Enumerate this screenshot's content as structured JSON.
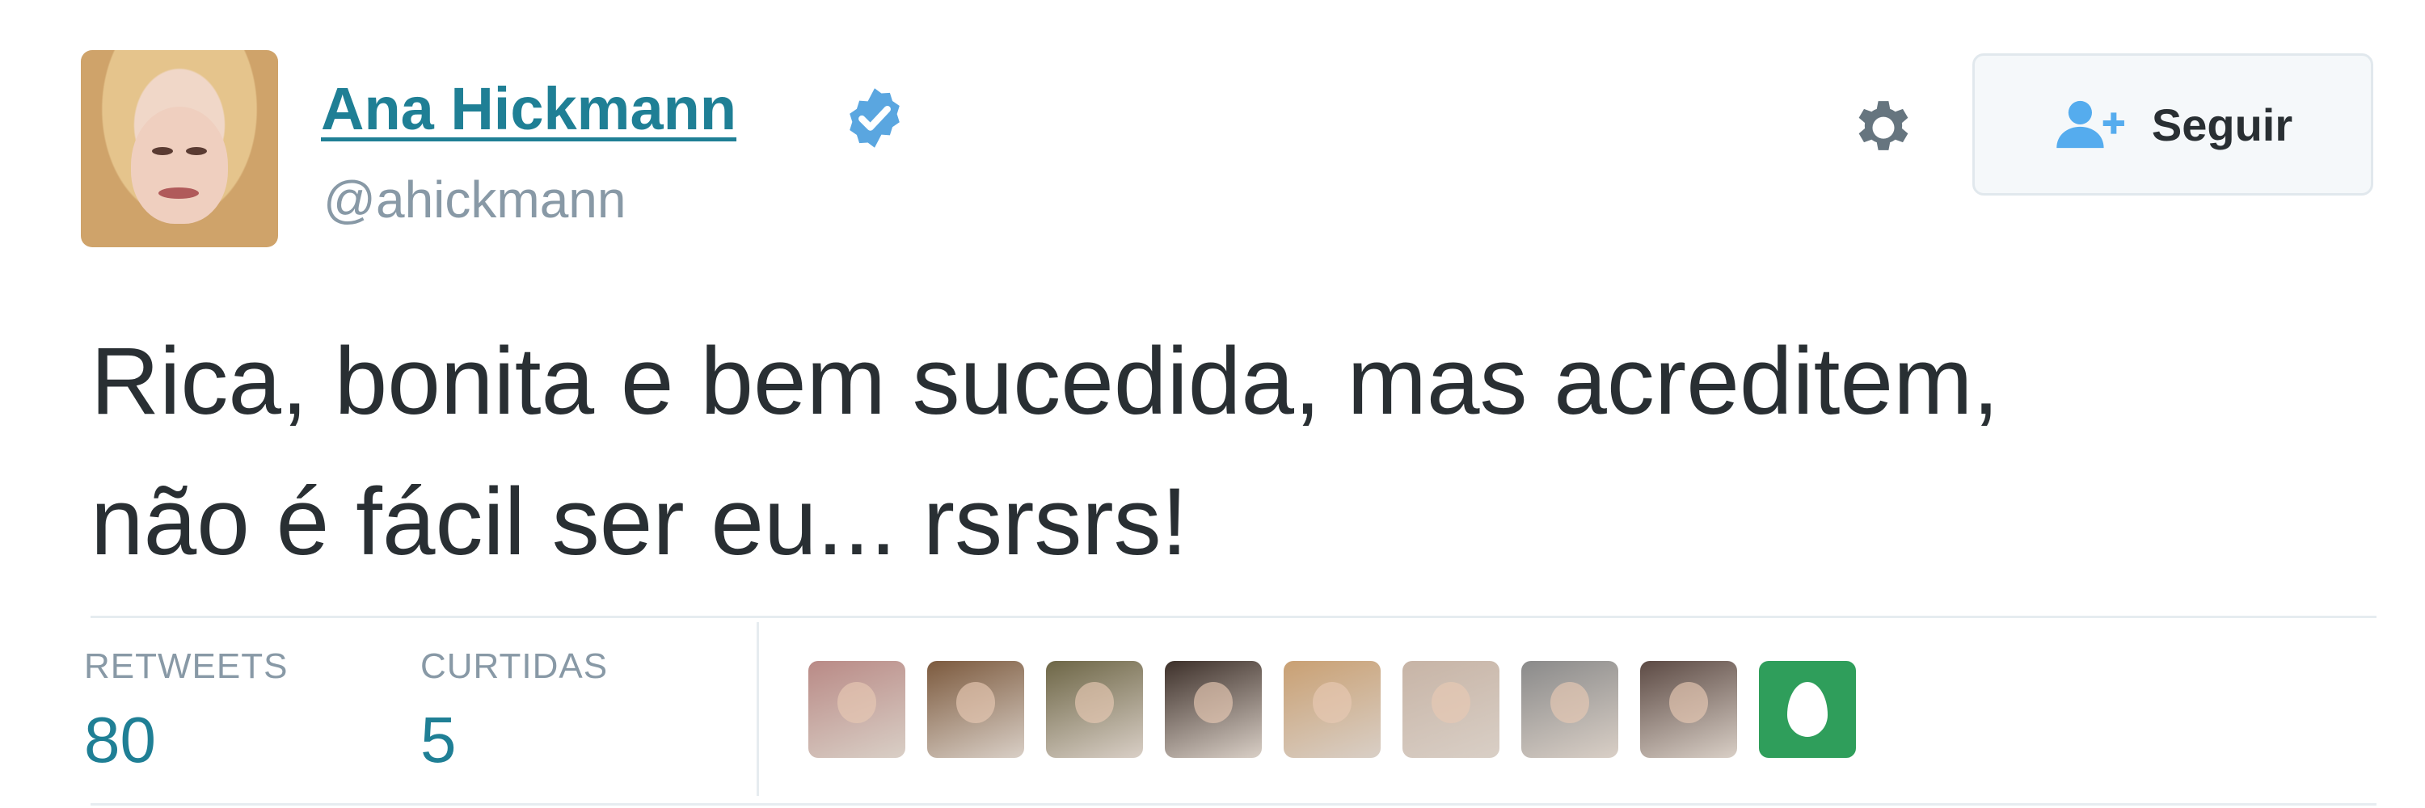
{
  "author": {
    "name": "Ana Hickmann",
    "handle": "@ahickmann",
    "verified_icon": "verified-badge-icon"
  },
  "actions": {
    "follow_label": "Seguir",
    "gear_icon": "gear-icon"
  },
  "tweet": {
    "text_line1": "Rica, bonita e bem sucedida, mas acreditem,",
    "text_line2": "não é fácil ser eu... rsrsrs!"
  },
  "stats": {
    "retweets_label": "RETWEETS",
    "retweets_value": "80",
    "likes_label": "CURTIDAS",
    "likes_value": "5"
  },
  "colors": {
    "link": "#1f7f95",
    "verified": "#5aa6e0",
    "egg": "#2f9e5b"
  },
  "likers": [
    {
      "color": "#b98a86"
    },
    {
      "color": "#7c5a3e"
    },
    {
      "color": "#6d6646"
    },
    {
      "color": "#3d302a"
    },
    {
      "color": "#c9a073"
    },
    {
      "color": "#c7b4a6"
    },
    {
      "color": "#8a8a8a"
    },
    {
      "color": "#5c4a44"
    }
  ]
}
